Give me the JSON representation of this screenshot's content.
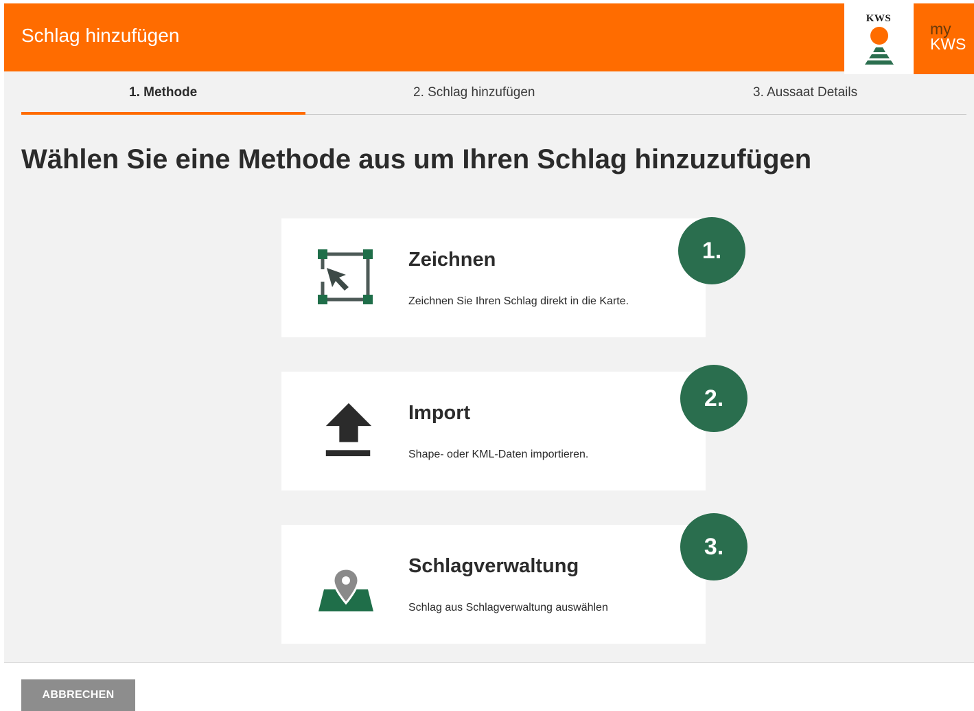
{
  "header": {
    "title": "Schlag hinzufügen",
    "logo_text": "KWS",
    "mykws_my": "my",
    "mykws_kws": "KWS",
    "brand_color": "#ff6c00"
  },
  "steps": [
    {
      "label": "1. Methode",
      "active": true
    },
    {
      "label": "2. Schlag hinzufügen",
      "active": false
    },
    {
      "label": "3. Aussaat Details",
      "active": false
    }
  ],
  "main": {
    "title": "Wählen Sie eine Methode aus um Ihren Schlag hinzuzufügen"
  },
  "methods": [
    {
      "icon": "draw-polygon-icon",
      "title": "Zeichnen",
      "description": "Zeichnen Sie Ihren Schlag direkt in die Karte.",
      "badge": "1."
    },
    {
      "icon": "upload-icon",
      "title": "Import",
      "description": "Shape- oder KML-Daten importieren.",
      "badge": "2."
    },
    {
      "icon": "map-pin-icon",
      "title": "Schlagverwaltung",
      "description": "Schlag aus Schlagverwaltung auswählen",
      "badge": "3."
    }
  ],
  "footer": {
    "cancel_label": "ABBRECHEN"
  },
  "colors": {
    "accent": "#ff6c00",
    "green": "#2a6e4e",
    "background": "#f2f2f2"
  }
}
